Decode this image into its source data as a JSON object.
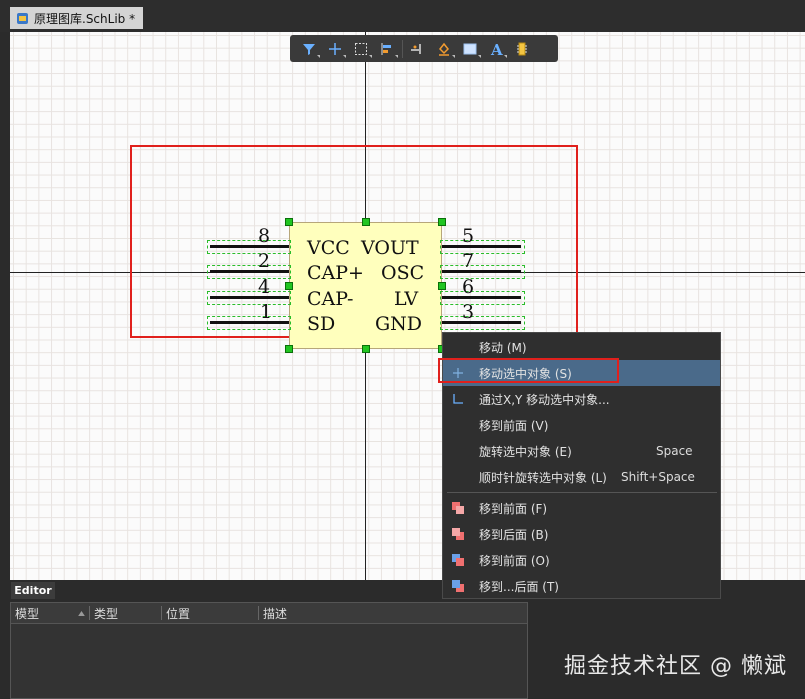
{
  "tab": {
    "title": "原理图库.SchLib *",
    "icon": "schlib-file-icon"
  },
  "toolbar": {
    "tools": [
      "filter-icon",
      "cross-icon",
      "select-rect-icon",
      "align-icon",
      "pin-icon",
      "fill-icon",
      "color-rect-icon",
      "text-icon",
      "part-icon"
    ]
  },
  "component": {
    "left_pins": [
      {
        "num": "8",
        "label": "VCC"
      },
      {
        "num": "2",
        "label": "CAP+"
      },
      {
        "num": "4",
        "label": "CAP-"
      },
      {
        "num": "1",
        "label": "SD"
      }
    ],
    "right_pins": [
      {
        "num": "5",
        "label": "VOUT"
      },
      {
        "num": "7",
        "label": "OSC"
      },
      {
        "num": "6",
        "label": "LV"
      },
      {
        "num": "3",
        "label": "GND"
      }
    ]
  },
  "context_menu": {
    "items": [
      {
        "label": "移动 (M)",
        "shortcut": ""
      },
      {
        "label": "移动选中对象 (S)",
        "shortcut": ""
      },
      {
        "label": "通过X,Y 移动选中对象...",
        "shortcut": ""
      },
      {
        "label": "移到前面 (V)",
        "shortcut": ""
      },
      {
        "label": "旋转选中对象 (E)",
        "shortcut": "Space"
      },
      {
        "label": "顺时针旋转选中对象 (L)",
        "shortcut": "Shift+Space"
      },
      {
        "label": "移到前面 (F)",
        "shortcut": ""
      },
      {
        "label": "移到后面 (B)",
        "shortcut": ""
      },
      {
        "label": "移到前面 (O)",
        "shortcut": ""
      },
      {
        "label": "移到...后面 (T)",
        "shortcut": ""
      }
    ]
  },
  "editor": {
    "tab_label": "Editor",
    "columns": [
      "模型",
      "类型",
      "位置",
      "描述"
    ]
  },
  "watermark": "掘金技术社区 @ 懒斌"
}
